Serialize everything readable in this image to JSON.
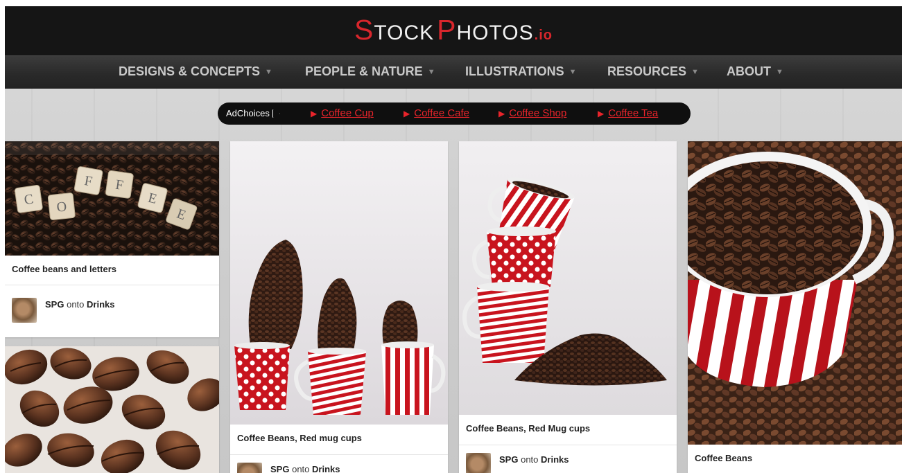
{
  "logo": {
    "s": "S",
    "tock": "TOCK",
    "p": "P",
    "hotos": "HOTOS",
    "io": ".io"
  },
  "nav": {
    "items": [
      {
        "label": "DESIGNS & CONCEPTS"
      },
      {
        "label": "PEOPLE & NATURE"
      },
      {
        "label": "ILLUSTRATIONS"
      },
      {
        "label": "RESOURCES"
      },
      {
        "label": "ABOUT"
      }
    ]
  },
  "ads": {
    "adchoices": "AdChoices",
    "links": [
      {
        "label": "Coffee Cup"
      },
      {
        "label": "Coffee Cafe"
      },
      {
        "label": "Coffee Shop"
      },
      {
        "label": "Coffee Tea"
      }
    ]
  },
  "cards": [
    {
      "title": "Coffee beans and letters",
      "user": "SPG",
      "onto": "onto",
      "board": "Drinks"
    },
    {
      "title": "Coffee Beans, Red mug cups",
      "user": "SPG",
      "onto": "onto",
      "board": "Drinks"
    },
    {
      "title": "Coffee Beans, Red Mug cups",
      "user": "SPG",
      "onto": "onto",
      "board": "Drinks"
    },
    {
      "title": "Coffee Beans"
    }
  ],
  "tiles": [
    "C",
    "O",
    "F",
    "F",
    "E",
    "E"
  ],
  "colors": {
    "accent": "#d8262c",
    "header": "#151515",
    "ad_link": "#e8242b"
  }
}
